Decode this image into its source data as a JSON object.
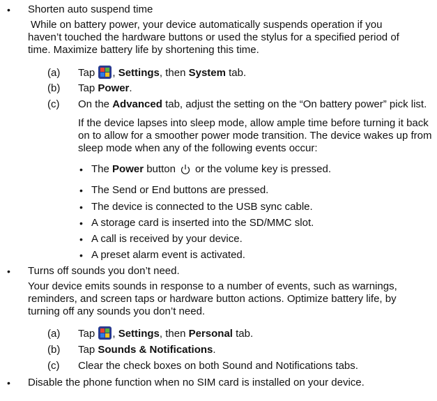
{
  "bullets": {
    "b1_title": "Shorten auto suspend time",
    "b1_para": [
      "While on battery power, your device automatically suspends operation if you",
      "haven’t touched the hardware buttons or used the stylus for a specified period of",
      "time. Maximize battery life by shortening this time."
    ],
    "b1_steps": {
      "a_label": "(a)",
      "a_tap": "Tap",
      "a_settings": "Settings",
      "a_then": ", then",
      "a_tab": "System",
      "a_tail": "tab.",
      "b_label": "(b)",
      "b_tap": "Tap",
      "b_bold": "Power",
      "b_tail": ".",
      "c_label": "(c)",
      "c_pre": "On the",
      "c_bold": "Advanced",
      "c_tail": "tab, adjust the setting on the “On battery power” pick list."
    },
    "b1_note": [
      "If the device lapses into sleep mode, allow ample time before turning it back",
      "on to allow for a smoother power mode transition. The device wakes up from",
      "sleep mode when any of the following events occur:"
    ],
    "events": {
      "e1_pre": "The",
      "e1_bold": "Power",
      "e1_mid": "button",
      "e1_tail": "or the volume key is pressed.",
      "e2": "The Send  or End buttons are pressed.",
      "e3": "The device is connected to the USB sync cable.",
      "e4": "A storage card is inserted into the SD/MMC slot.",
      "e5": "A call is received by your device.",
      "e6": "A preset alarm event is activated."
    },
    "b2_title": "Turns off sounds you don’t need.",
    "b2_para": [
      "Your device emits sounds in response to a number of events, such as warnings,",
      "reminders, and screen taps or hardware button actions. Optimize battery life, by",
      "turning off any sounds you don’t need."
    ],
    "b2_steps": {
      "a_label": "(a)",
      "a_tap": "Tap",
      "a_settings": "Settings",
      "a_then": ", then",
      "a_tab": "Personal",
      "a_tail": "tab.",
      "b_label": "(b)",
      "b_tap": "Tap",
      "b_bold": "Sounds & Notifications",
      "b_tail": ".",
      "c_label": "(c)",
      "c_text": "Clear the check boxes on both Sound and Notifications tabs."
    },
    "b3_title": "Disable the phone function when no SIM card is installed on your device."
  },
  "icons": {
    "start": "windows-start-icon",
    "power": "power-icon",
    "bullet": "bullet-dot"
  },
  "colors": {
    "text": "#111111",
    "start_icon_bg": "#2a3b8f"
  }
}
